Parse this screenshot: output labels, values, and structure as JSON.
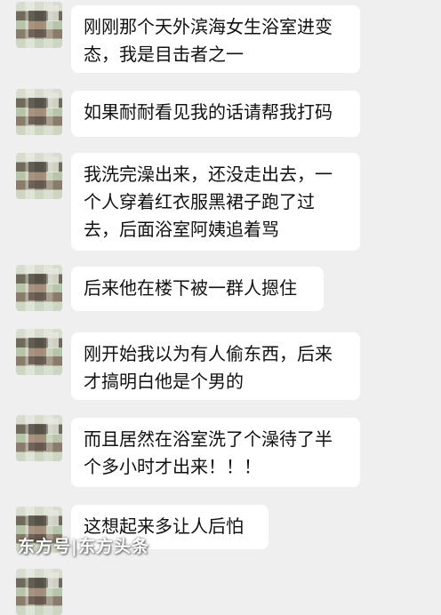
{
  "chat": {
    "messages": [
      {
        "text": "刚刚那个天外滨海女生浴室进变态，我是目击者之一"
      },
      {
        "text": "如果耐耐看见我的话请帮我打码"
      },
      {
        "text": "我洗完澡出来，还没走出去，一个人穿着红衣服黑裙子跑了过去，后面浴室阿姨追着骂"
      },
      {
        "text": "后来他在楼下被一群人摁住"
      },
      {
        "text": "刚开始我以为有人偷东西，后来才搞明白他是个男的"
      },
      {
        "text": "而且居然在浴室洗了个澡待了半个多小时才出来！！！"
      },
      {
        "text": "这想起来多让人后怕"
      }
    ]
  },
  "watermark": {
    "text": "东方号|东方头条"
  }
}
